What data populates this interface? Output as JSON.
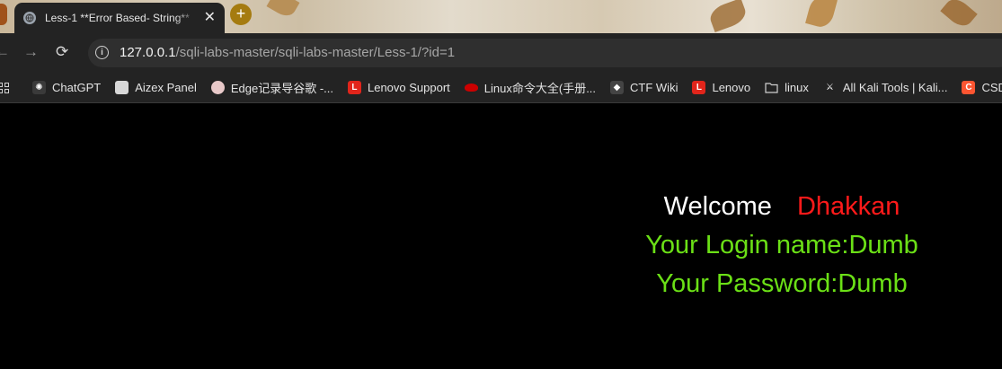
{
  "tab": {
    "title": "Less-1 **Error Based- String**",
    "close_glyph": "✕",
    "new_tab_glyph": "+"
  },
  "toolbar": {
    "back_glyph": "←",
    "forward_glyph": "→",
    "reload_glyph": "⟳",
    "url_host": "127.0.0.1",
    "url_path": "/sqli-labs-master/sqli-labs-master/Less-1/?id=1"
  },
  "bookmarks": [
    {
      "label": "ChatGPT",
      "icon": "chatgpt-icon",
      "color": "#3a3a3a",
      "glyph": "✺"
    },
    {
      "label": "Aizex Panel",
      "icon": "aizex-icon",
      "color": "#d8d8d8",
      "glyph": ""
    },
    {
      "label": "Edge记录导谷歌 -...",
      "icon": "avatar-icon",
      "color": "#e8c9c9",
      "glyph": ""
    },
    {
      "label": "Lenovo Support",
      "icon": "lenovo-icon",
      "color": "#e1251b",
      "glyph": "L"
    },
    {
      "label": "Linux命令大全(手册...",
      "icon": "redhat-icon",
      "color": "#cc0000",
      "glyph": ""
    },
    {
      "label": "CTF Wiki",
      "icon": "ctf-icon",
      "color": "#444",
      "glyph": "◆"
    },
    {
      "label": "Lenovo",
      "icon": "lenovo-icon",
      "color": "#e1251b",
      "glyph": "L"
    },
    {
      "label": "linux",
      "icon": "folder-icon",
      "color": "transparent",
      "glyph": ""
    },
    {
      "label": "All Kali Tools | Kali...",
      "icon": "kali-icon",
      "color": "transparent",
      "glyph": "⚔"
    },
    {
      "label": "CSDN",
      "icon": "csdn-icon",
      "color": "#fc5531",
      "glyph": "C"
    }
  ],
  "content": {
    "welcome": "Welcome",
    "user": "Dhakkan",
    "login": "Your Login name:Dumb",
    "password": "Your Password:Dumb"
  }
}
